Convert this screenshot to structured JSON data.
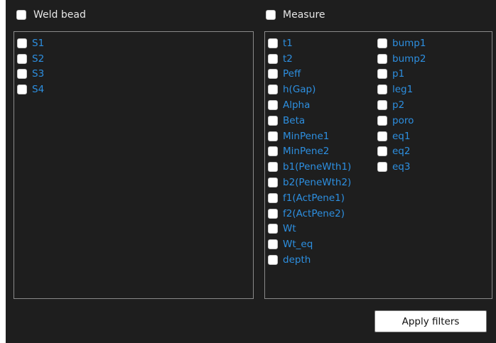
{
  "weld_bead": {
    "header": "Weld bead",
    "items": [
      "S1",
      "S2",
      "S3",
      "S4"
    ]
  },
  "measure": {
    "header": "Measure",
    "col1": [
      "t1",
      "t2",
      "Peff",
      "h(Gap)",
      "Alpha",
      "Beta",
      "MinPene1",
      "MinPene2",
      "b1(PeneWth1)",
      "b2(PeneWth2)",
      "f1(ActPene1)",
      "f2(ActPene2)",
      "Wt",
      "Wt_eq",
      "depth"
    ],
    "col2": [
      "bump1",
      "bump2",
      "p1",
      "leg1",
      "p2",
      "poro",
      "eq1",
      "eq2",
      "eq3"
    ]
  },
  "apply_button": "Apply filters",
  "colors": {
    "background": "#1e1e1e",
    "item_text": "#2d8fe0",
    "header_text": "#e6e6e6"
  }
}
